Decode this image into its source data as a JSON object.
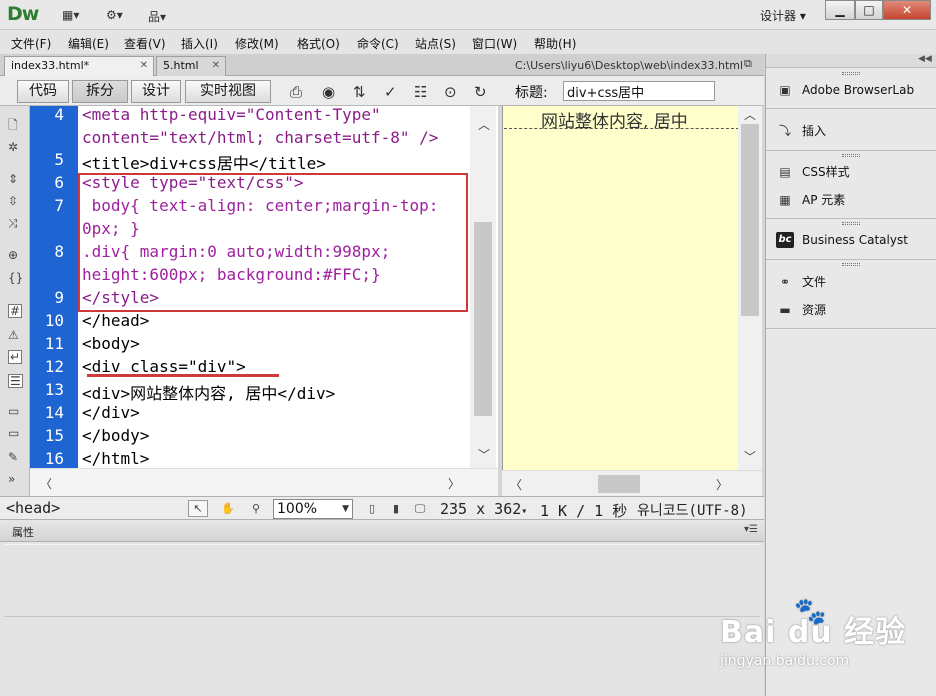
{
  "app": {
    "logo": "Dw",
    "workspace_label": "设计器",
    "window_min": "▁",
    "window_max": "□",
    "window_close": "✕"
  },
  "menu": [
    "文件(F)",
    "编辑(E)",
    "查看(V)",
    "插入(I)",
    "修改(M)",
    "格式(O)",
    "命令(C)",
    "站点(S)",
    "窗口(W)",
    "帮助(H)"
  ],
  "doc_tabs": [
    {
      "label": "index33.html*",
      "active": true
    },
    {
      "label": "5.html",
      "active": false
    }
  ],
  "file_path": "C:\\Users\\liyu6\\Desktop\\web\\index33.html",
  "view_buttons": [
    "代码",
    "拆分",
    "设计",
    "实时视图"
  ],
  "active_view": "拆分",
  "page_title": {
    "label": "标题:",
    "value": "div+css居中"
  },
  "code_lines": [
    {
      "num": "4",
      "text": "<meta http-equiv=\"Content-Type\""
    },
    {
      "num": "",
      "text": "content=\"text/html; charset=utf-8\" />"
    },
    {
      "num": "5",
      "text": "<title>div+css居中</title>"
    },
    {
      "num": "6",
      "text": "<style type=\"text/css\">"
    },
    {
      "num": "7",
      "text": " body{ text-align: center;margin-top:"
    },
    {
      "num": "",
      "text": "0px; }"
    },
    {
      "num": "8",
      "text": ".div{ margin:0 auto;width:998px;"
    },
    {
      "num": "",
      "text": "height:600px; background:#FFC;}"
    },
    {
      "num": "9",
      "text": "</style>"
    },
    {
      "num": "10",
      "text": "</head>"
    },
    {
      "num": "11",
      "text": "<body>"
    },
    {
      "num": "12",
      "text": "<div class=\"div\">"
    },
    {
      "num": "13",
      "text": "<div>网站整体内容, 居中</div>"
    },
    {
      "num": "14",
      "text": "</div>"
    },
    {
      "num": "15",
      "text": "</body>"
    },
    {
      "num": "16",
      "text": "</html>"
    }
  ],
  "design_text": "网站整体内容, 居中",
  "status": {
    "tag": "<head>",
    "zoom": "100%",
    "dimensions": "235 x 362",
    "size": "1 K / 1 秒",
    "encoding": "유니코드(UTF-8)"
  },
  "properties": {
    "title": "属性"
  },
  "right_panel": {
    "items": [
      "Adobe BrowserLab",
      "插入",
      "CSS样式",
      "AP 元素",
      "Business Catalyst",
      "文件",
      "资源"
    ]
  },
  "watermark": {
    "logo": "Bai du 经验",
    "url": "jingyan.baidu.com"
  },
  "colors": {
    "gutter": "#1e64d2",
    "highlight": "#d0393c",
    "design_bg": "#ffffcc"
  }
}
